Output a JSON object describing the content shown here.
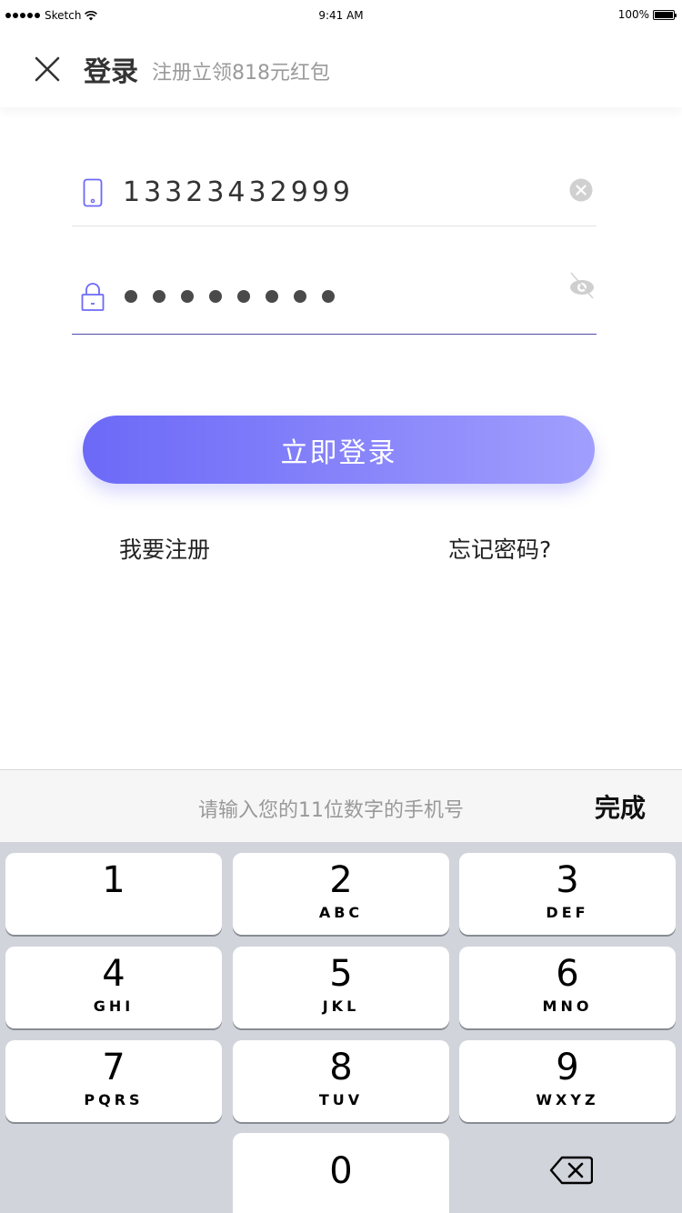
{
  "status_bar": {
    "carrier": "Sketch",
    "time": "9:41 AM",
    "battery": "100%"
  },
  "header": {
    "title": "登录",
    "subtitle": "注册立领818元红包"
  },
  "form": {
    "phone_value": "13323432999",
    "password_mask_count": 8
  },
  "login_button": {
    "label": "立即登录"
  },
  "links": {
    "register": "我要注册",
    "forgot": "忘记密码?"
  },
  "keyboard_bar": {
    "hint": "请输入您的11位数字的手机号",
    "done": "完成"
  },
  "keypad": {
    "keys": [
      {
        "digit": "1",
        "letters": ""
      },
      {
        "digit": "2",
        "letters": "ABC"
      },
      {
        "digit": "3",
        "letters": "DEF"
      },
      {
        "digit": "4",
        "letters": "GHI"
      },
      {
        "digit": "5",
        "letters": "JKL"
      },
      {
        "digit": "6",
        "letters": "MNO"
      },
      {
        "digit": "7",
        "letters": "PQRS"
      },
      {
        "digit": "8",
        "letters": "TUV"
      },
      {
        "digit": "9",
        "letters": "WXYZ"
      },
      {
        "digit": "0",
        "letters": ""
      }
    ]
  },
  "colors": {
    "accent": "#6c69f8",
    "accent_light": "#a19ffd",
    "keypad_bg": "#d1d4db"
  },
  "icons": {
    "close": "close-icon",
    "phone": "phone-icon",
    "clear": "clear-icon",
    "lock": "lock-icon",
    "eye": "eye-off-icon",
    "delete": "backspace-icon"
  }
}
